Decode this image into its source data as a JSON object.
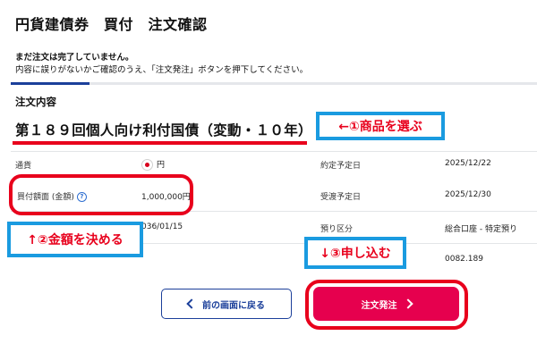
{
  "header": {
    "title": "円貨建債券　買付　注文確認"
  },
  "notice": {
    "line1": "まだ注文は完了していません。",
    "line2": "内容に誤りがないかご確認のうえ、「注文発注」ボタンを押下してください。"
  },
  "section": {
    "title": "注文内容"
  },
  "product": {
    "name": "第１８９回個人向け利付国債（変動・１０年）"
  },
  "details": {
    "currency": {
      "label": "通貨",
      "value": "円",
      "flag": "japan-flag-icon"
    },
    "face_value": {
      "label": "買付額面 (金額)",
      "value": "1,000,000円",
      "help": "?"
    },
    "contract_date": {
      "label": "約定予定日",
      "value": "2025/12/22"
    },
    "delivery_date": {
      "label": "受渡予定日",
      "value": "2025/12/30"
    },
    "partial_value": "036/01/15",
    "custody": {
      "label": "預り区分",
      "value": "総合口座 - 特定預り"
    },
    "price_value": "0082.189"
  },
  "annotations": {
    "step1": "←①商品を選ぶ",
    "step2": "↑②金額を決める",
    "step3": "↓③申し込む"
  },
  "buttons": {
    "back": "前の画面に戻る",
    "order": "注文発注"
  },
  "colors": {
    "accent_red": "#e8001c",
    "brand_blue": "#1b3f9a",
    "callout_blue": "#1a9be0",
    "order_button": "#e6004e"
  }
}
